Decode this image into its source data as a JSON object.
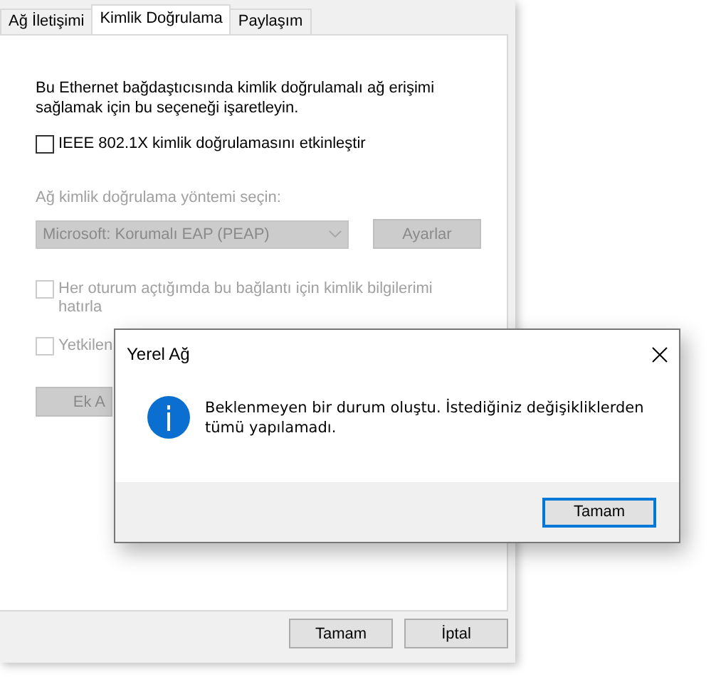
{
  "tabs": [
    {
      "label": "Ağ İletişimi",
      "selected": false
    },
    {
      "label": "Kimlik Doğrulama",
      "selected": true
    },
    {
      "label": "Paylaşım",
      "selected": false
    }
  ],
  "intro": "Bu Ethernet bağdaştıcısında kimlik doğrulamalı ağ erişimi sağlamak için bu seçeneği işaretleyin.",
  "enable_checkbox": {
    "label": "IEEE 802.1X kimlik doğrulamasını etkinleştir",
    "checked": false,
    "disabled": false
  },
  "method_label": "Ağ kimlik doğrulama yöntemi seçin:",
  "method_select": {
    "value": "Microsoft: Korumalı EAP (PEAP)",
    "disabled": true
  },
  "settings_button": {
    "label": "Ayarlar",
    "disabled": true
  },
  "options": [
    {
      "label": "Her oturum açtığımda bu bağlantı için kimlik bilgilerimi hatırla",
      "checked": false,
      "disabled": true
    },
    {
      "label": "Yetkilen",
      "checked": false,
      "disabled": true
    }
  ],
  "extra_button": {
    "label": "Ek A",
    "disabled": true
  },
  "buttons": [
    "Tamam",
    "İptal"
  ],
  "dialog": {
    "title": "Yerel Ağ",
    "message": "Beklenmeyen bir durum oluştu. İstediğiniz değişikliklerden tümü yapılamadı.",
    "button": "Tamam"
  }
}
